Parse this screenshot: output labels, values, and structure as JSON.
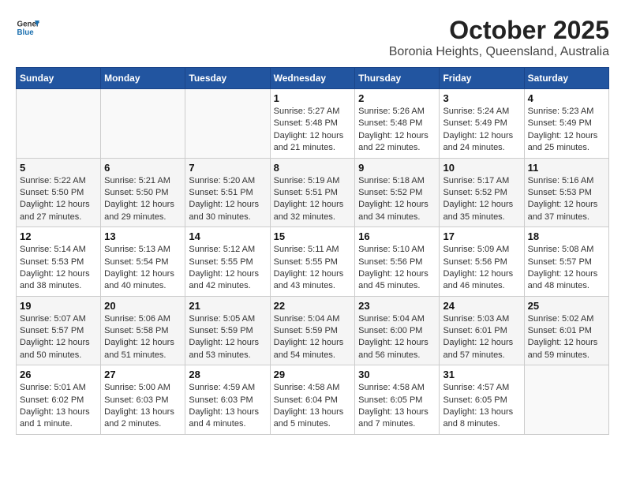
{
  "header": {
    "logo_general": "General",
    "logo_blue": "Blue",
    "title": "October 2025",
    "subtitle": "Boronia Heights, Queensland, Australia"
  },
  "calendar": {
    "days_of_week": [
      "Sunday",
      "Monday",
      "Tuesday",
      "Wednesday",
      "Thursday",
      "Friday",
      "Saturday"
    ],
    "weeks": [
      [
        {
          "day": "",
          "info": ""
        },
        {
          "day": "",
          "info": ""
        },
        {
          "day": "",
          "info": ""
        },
        {
          "day": "1",
          "info": "Sunrise: 5:27 AM\nSunset: 5:48 PM\nDaylight: 12 hours\nand 21 minutes."
        },
        {
          "day": "2",
          "info": "Sunrise: 5:26 AM\nSunset: 5:48 PM\nDaylight: 12 hours\nand 22 minutes."
        },
        {
          "day": "3",
          "info": "Sunrise: 5:24 AM\nSunset: 5:49 PM\nDaylight: 12 hours\nand 24 minutes."
        },
        {
          "day": "4",
          "info": "Sunrise: 5:23 AM\nSunset: 5:49 PM\nDaylight: 12 hours\nand 25 minutes."
        }
      ],
      [
        {
          "day": "5",
          "info": "Sunrise: 5:22 AM\nSunset: 5:50 PM\nDaylight: 12 hours\nand 27 minutes."
        },
        {
          "day": "6",
          "info": "Sunrise: 5:21 AM\nSunset: 5:50 PM\nDaylight: 12 hours\nand 29 minutes."
        },
        {
          "day": "7",
          "info": "Sunrise: 5:20 AM\nSunset: 5:51 PM\nDaylight: 12 hours\nand 30 minutes."
        },
        {
          "day": "8",
          "info": "Sunrise: 5:19 AM\nSunset: 5:51 PM\nDaylight: 12 hours\nand 32 minutes."
        },
        {
          "day": "9",
          "info": "Sunrise: 5:18 AM\nSunset: 5:52 PM\nDaylight: 12 hours\nand 34 minutes."
        },
        {
          "day": "10",
          "info": "Sunrise: 5:17 AM\nSunset: 5:52 PM\nDaylight: 12 hours\nand 35 minutes."
        },
        {
          "day": "11",
          "info": "Sunrise: 5:16 AM\nSunset: 5:53 PM\nDaylight: 12 hours\nand 37 minutes."
        }
      ],
      [
        {
          "day": "12",
          "info": "Sunrise: 5:14 AM\nSunset: 5:53 PM\nDaylight: 12 hours\nand 38 minutes."
        },
        {
          "day": "13",
          "info": "Sunrise: 5:13 AM\nSunset: 5:54 PM\nDaylight: 12 hours\nand 40 minutes."
        },
        {
          "day": "14",
          "info": "Sunrise: 5:12 AM\nSunset: 5:55 PM\nDaylight: 12 hours\nand 42 minutes."
        },
        {
          "day": "15",
          "info": "Sunrise: 5:11 AM\nSunset: 5:55 PM\nDaylight: 12 hours\nand 43 minutes."
        },
        {
          "day": "16",
          "info": "Sunrise: 5:10 AM\nSunset: 5:56 PM\nDaylight: 12 hours\nand 45 minutes."
        },
        {
          "day": "17",
          "info": "Sunrise: 5:09 AM\nSunset: 5:56 PM\nDaylight: 12 hours\nand 46 minutes."
        },
        {
          "day": "18",
          "info": "Sunrise: 5:08 AM\nSunset: 5:57 PM\nDaylight: 12 hours\nand 48 minutes."
        }
      ],
      [
        {
          "day": "19",
          "info": "Sunrise: 5:07 AM\nSunset: 5:57 PM\nDaylight: 12 hours\nand 50 minutes."
        },
        {
          "day": "20",
          "info": "Sunrise: 5:06 AM\nSunset: 5:58 PM\nDaylight: 12 hours\nand 51 minutes."
        },
        {
          "day": "21",
          "info": "Sunrise: 5:05 AM\nSunset: 5:59 PM\nDaylight: 12 hours\nand 53 minutes."
        },
        {
          "day": "22",
          "info": "Sunrise: 5:04 AM\nSunset: 5:59 PM\nDaylight: 12 hours\nand 54 minutes."
        },
        {
          "day": "23",
          "info": "Sunrise: 5:04 AM\nSunset: 6:00 PM\nDaylight: 12 hours\nand 56 minutes."
        },
        {
          "day": "24",
          "info": "Sunrise: 5:03 AM\nSunset: 6:01 PM\nDaylight: 12 hours\nand 57 minutes."
        },
        {
          "day": "25",
          "info": "Sunrise: 5:02 AM\nSunset: 6:01 PM\nDaylight: 12 hours\nand 59 minutes."
        }
      ],
      [
        {
          "day": "26",
          "info": "Sunrise: 5:01 AM\nSunset: 6:02 PM\nDaylight: 13 hours\nand 1 minute."
        },
        {
          "day": "27",
          "info": "Sunrise: 5:00 AM\nSunset: 6:03 PM\nDaylight: 13 hours\nand 2 minutes."
        },
        {
          "day": "28",
          "info": "Sunrise: 4:59 AM\nSunset: 6:03 PM\nDaylight: 13 hours\nand 4 minutes."
        },
        {
          "day": "29",
          "info": "Sunrise: 4:58 AM\nSunset: 6:04 PM\nDaylight: 13 hours\nand 5 minutes."
        },
        {
          "day": "30",
          "info": "Sunrise: 4:58 AM\nSunset: 6:05 PM\nDaylight: 13 hours\nand 7 minutes."
        },
        {
          "day": "31",
          "info": "Sunrise: 4:57 AM\nSunset: 6:05 PM\nDaylight: 13 hours\nand 8 minutes."
        },
        {
          "day": "",
          "info": ""
        }
      ]
    ]
  }
}
